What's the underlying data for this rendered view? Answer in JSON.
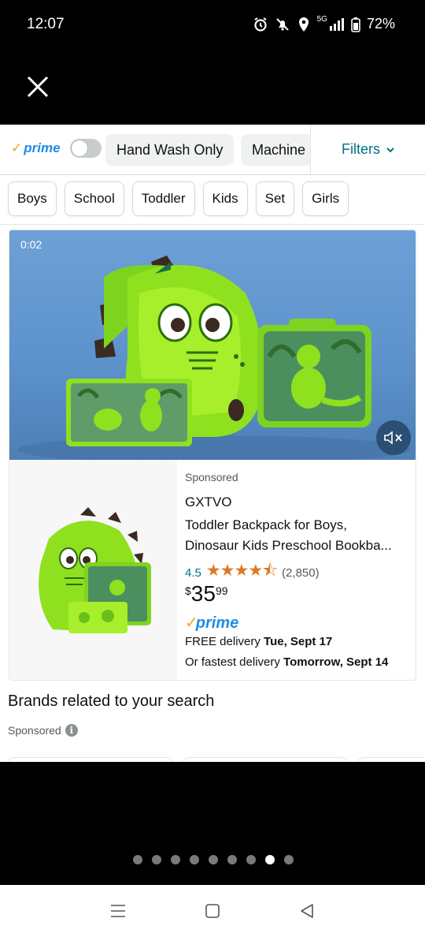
{
  "status_bar": {
    "time": "12:07",
    "network": "5G",
    "battery": "72%",
    "icons": [
      "alarm-icon",
      "mute-icon",
      "location-icon",
      "signal-icon",
      "battery-icon"
    ]
  },
  "top_bar": {
    "close_icon": "close-icon"
  },
  "filters": {
    "prime_label": "prime",
    "prime_check": "✓",
    "prime_toggle_on": false,
    "chips": [
      "Hand Wash Only",
      "Machine"
    ],
    "filters_label": "Filters",
    "quick_chips": [
      "Boys",
      "School",
      "Toddler",
      "Kids",
      "Set",
      "Girls"
    ]
  },
  "product": {
    "video_time": "0:02",
    "sponsored": "Sponsored",
    "brand": "GXTVO",
    "title_line1": "Toddler Backpack for Boys,",
    "title_line2": "Dinosaur Kids Preschool Bookba...",
    "rating": "4.5",
    "stars": "★★★★⯪",
    "rating_count": "(2,850)",
    "price_symbol": "$",
    "price_whole": "35",
    "price_fraction": "99",
    "prime_check": "✓",
    "prime_label": "prime",
    "delivery_prefix": "FREE delivery ",
    "delivery_date": "Tue, Sept 17",
    "fastest_prefix": "Or fastest delivery ",
    "fastest_date": "Tomorrow, Sept 14"
  },
  "brands": {
    "title": "Brands related to your search",
    "sponsored": "Sponsored",
    "info_icon": "i"
  },
  "carousel": {
    "dot_count": 9,
    "active_index": 7
  },
  "colors": {
    "prime_blue": "#1f8ce6",
    "prime_orange": "#f7a31c",
    "link_teal": "#007185",
    "star_orange": "#de7921"
  }
}
